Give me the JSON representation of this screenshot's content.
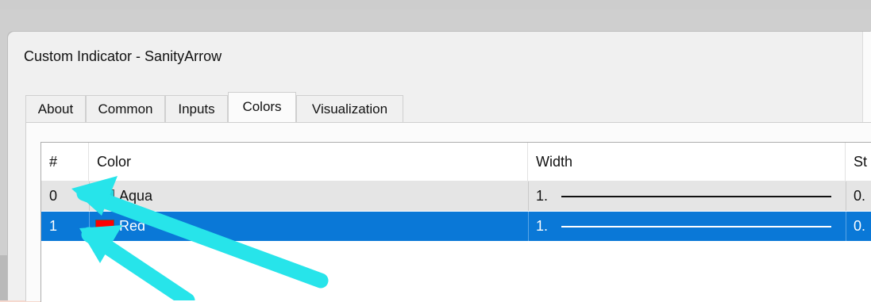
{
  "dialog": {
    "title": "Custom Indicator - SanityArrow"
  },
  "tabs": [
    {
      "label": "About",
      "active": false
    },
    {
      "label": "Common",
      "active": false
    },
    {
      "label": "Inputs",
      "active": false
    },
    {
      "label": "Colors",
      "active": true
    },
    {
      "label": "Visualization",
      "active": false
    }
  ],
  "table": {
    "headers": {
      "index": "#",
      "color": "Color",
      "width": "Width",
      "style": "St"
    },
    "rows": [
      {
        "index": "0",
        "color_name": "Aqua",
        "swatch": "#25d6e0",
        "width": "1.",
        "style": "0.",
        "selected": false
      },
      {
        "index": "1",
        "color_name": "Red",
        "swatch": "#ff0000",
        "width": "1.",
        "style": "0.",
        "selected": true
      }
    ]
  },
  "colors": {
    "selection": "#0a78d7",
    "arrow": "#27e4ea"
  }
}
